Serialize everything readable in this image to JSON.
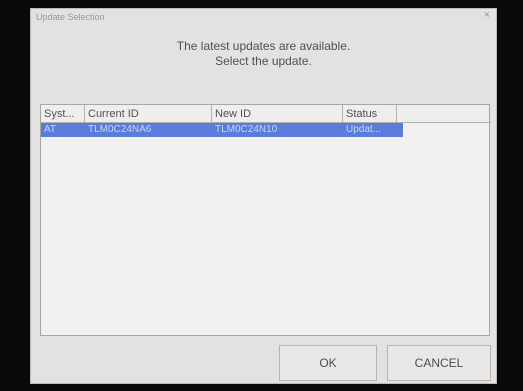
{
  "dialog": {
    "title": "Update Selection",
    "close_glyph": "×",
    "message_line1": "The latest updates are available.",
    "message_line2": "Select the update."
  },
  "list": {
    "columns": [
      "Syst...",
      "Current ID",
      "New ID",
      "Status"
    ],
    "rows": [
      {
        "system": "AT",
        "current_id": "TLM0C24NA6",
        "new_id": "TLM0C24N10",
        "status": "Updat..."
      }
    ]
  },
  "buttons": {
    "ok_label": "OK",
    "cancel_label": "CANCEL"
  },
  "colors": {
    "selection": "#5b7cd8",
    "dialog_bg": "#e4e2e0"
  }
}
